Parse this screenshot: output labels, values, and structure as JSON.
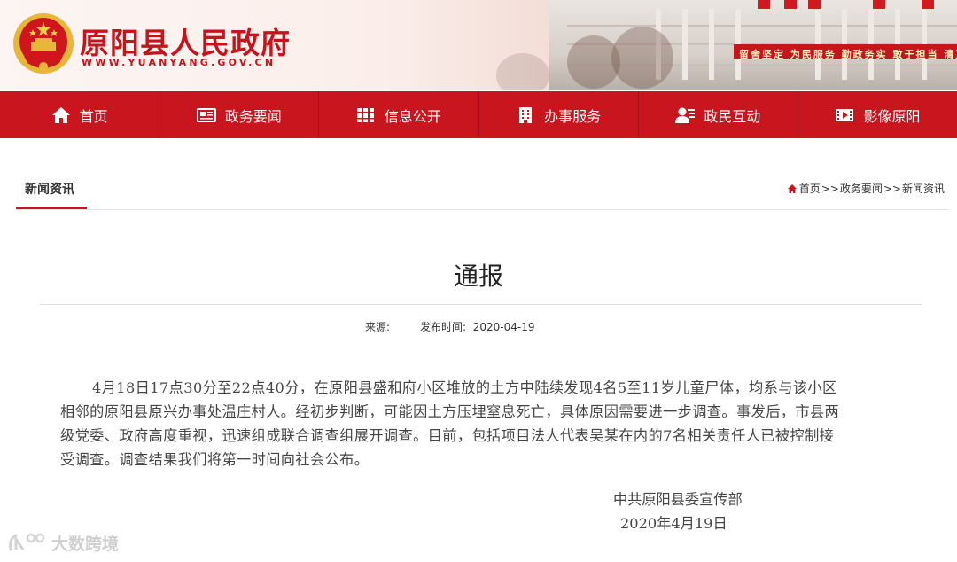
{
  "site": {
    "title": "原阳县人民政府",
    "url": "WWW.YUANYANG.GOV.CN",
    "banner_text": "留舍坚定 为民服务 勤政务实 敢于担当 清正廉洁"
  },
  "nav": {
    "items": [
      {
        "label": "首页",
        "icon": "home-icon"
      },
      {
        "label": "政务要闻",
        "icon": "newspaper-icon"
      },
      {
        "label": "信息公开",
        "icon": "books-icon"
      },
      {
        "label": "办事服务",
        "icon": "building-icon"
      },
      {
        "label": "政民互动",
        "icon": "user-chat-icon"
      },
      {
        "label": "影像原阳",
        "icon": "film-icon"
      }
    ]
  },
  "section": {
    "title": "新闻资讯",
    "breadcrumb": [
      "首页",
      "政务要闻",
      "新闻资讯"
    ],
    "separator": ">>"
  },
  "article": {
    "title": "通报",
    "source_label": "来源:",
    "date_label": "发布时间:",
    "date": "2020-04-19",
    "body": "4月18日17点30分至22点40分，在原阳县盛和府小区堆放的土方中陆续发现4名5至11岁儿童尸体，均系与该小区相邻的原阳县原兴办事处温庄村人。经初步判断，可能因土方压埋窒息死亡，具体原因需要进一步调查。事发后，市县两级党委、政府高度重视，迅速组成联合调查组展开调查。目前，包括项目法人代表吴某在内的7名相关责任人已被控制接受调查。调查结果我们将第一时间向社会公布。",
    "signature": "中共原阳县委宣传部",
    "signature_date": "2020年4月19日"
  },
  "watermark": {
    "text": "大数跨境"
  },
  "colors": {
    "brand_red": "#c9151e",
    "title_red": "#c7141c"
  }
}
